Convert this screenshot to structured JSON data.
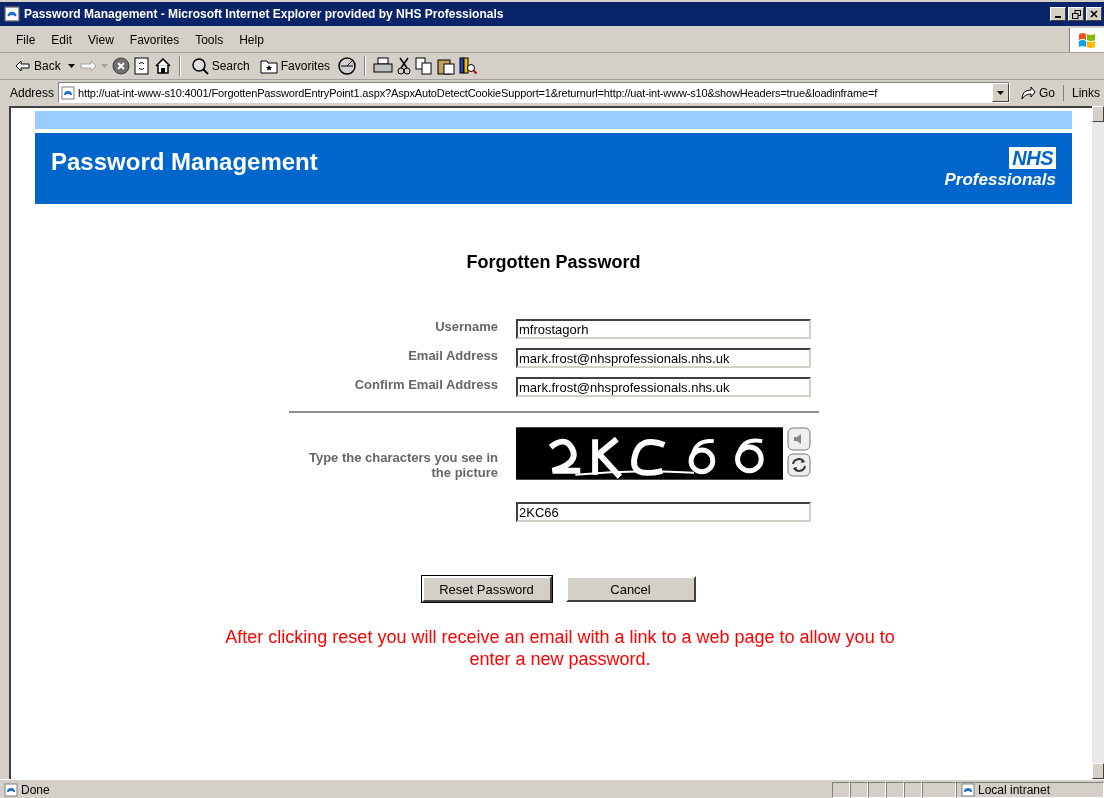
{
  "window": {
    "title": "Password Management - Microsoft Internet Explorer provided by NHS Professionals"
  },
  "menu": [
    "File",
    "Edit",
    "View",
    "Favorites",
    "Tools",
    "Help"
  ],
  "toolbar": {
    "back": "Back",
    "search": "Search",
    "favorites": "Favorites"
  },
  "address_bar": {
    "label": "Address",
    "url": "http://uat-int-www-s10:4001/ForgottenPasswordEntryPoint1.aspx?AspxAutoDetectCookieSupport=1&returnurl=http://uat-int-www-s10&showHeaders=true&loadinframe=f",
    "go": "Go",
    "links": "Links"
  },
  "page": {
    "header_title": "Password Management",
    "logo": {
      "top": "NHS",
      "bottom": "Professionals"
    },
    "heading": "Forgotten Password",
    "fields": [
      {
        "label": "Username",
        "value": "mfrostagorh"
      },
      {
        "label": "Email Address",
        "value": "mark.frost@nhsprofessionals.nhs.uk"
      },
      {
        "label": "Confirm Email Address",
        "value": "mark.frost@nhsprofessionals.nhs.uk"
      }
    ],
    "captcha": {
      "label": "Type the characters you see in the picture",
      "value": "2KC66"
    },
    "buttons": [
      "Reset Password",
      "Cancel"
    ],
    "notice": "After clicking reset you will receive an email with a link to a web page to allow you to enter a new password."
  },
  "status_bar": {
    "text": "Done",
    "zone": "Local intranet"
  }
}
